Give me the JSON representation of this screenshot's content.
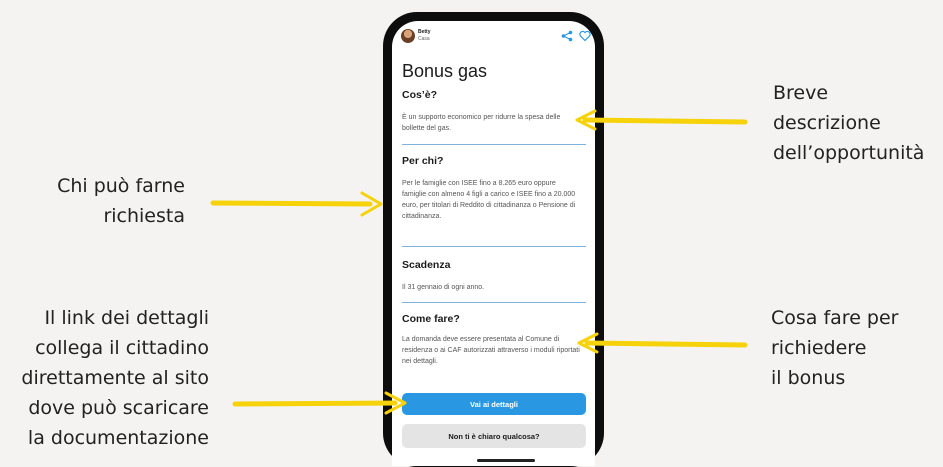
{
  "annotations": {
    "descrizione": [
      "Breve",
      "descrizione",
      "dell’opportunità"
    ],
    "per_chi": [
      "Chi può farne",
      "richiesta"
    ],
    "come_fare": [
      "Cosa fare per",
      "richiedere",
      "il bonus"
    ],
    "link": [
      "Il link dei dettagli",
      "collega il cittadino",
      "direttamente al sito",
      "dove può scaricare",
      "la documentazione"
    ]
  },
  "app": {
    "user_name": "Betty",
    "user_subtitle": "Casa",
    "title": "Bonus gas",
    "sections": [
      {
        "title": "Cos’è?",
        "text": "È un supporto economico per ridurre la spesa delle bollette del gas."
      },
      {
        "title": "Per chi?",
        "text": "Per le famiglie con ISEE fino a 8.265 euro oppure famiglie con almeno 4 figli a carico e ISEE fino a 20.000 euro, per titolari di Reddito di cittadinanza o Pensione di cittadinanza."
      },
      {
        "title": "Scadenza",
        "text": "Il 31 gennaio di ogni anno."
      },
      {
        "title": "Come fare?",
        "text": "La domanda deve essere presentata al Comune di residenza o ai CAF autorizzati attraverso i moduli riportati nei dettagli."
      }
    ],
    "primary_button": "Vai ai dettagli",
    "secondary_button": "Non ti è chiaro qualcosa?"
  },
  "colors": {
    "accent": "#2a97e3",
    "arrow": "#f5d20a",
    "divider": "#7fb3df",
    "background": "#f4f3f1"
  }
}
